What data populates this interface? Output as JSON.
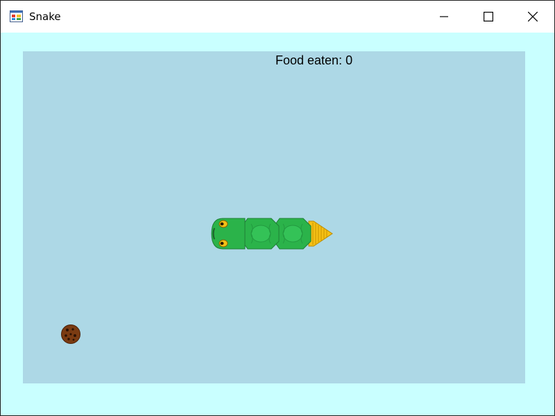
{
  "window": {
    "title": "Snake",
    "app_icon": "winforms-app-icon",
    "controls": [
      "minimize-icon",
      "maximize-icon",
      "close-icon"
    ]
  },
  "game": {
    "score_label": "Food eaten:",
    "score_value": 0,
    "score_text": "Food eaten: 0",
    "direction": "left",
    "snake_segments": [
      "head",
      "body",
      "body",
      "tail"
    ],
    "food_item": "cookie"
  },
  "colors": {
    "client_background": "#c9ffff",
    "board_background": "#add8e6",
    "snake_green": "#2bb34a",
    "snake_dark": "#1f7f35",
    "tail_yellow": "#f5c016",
    "cookie_brown": "#7a3b12"
  }
}
